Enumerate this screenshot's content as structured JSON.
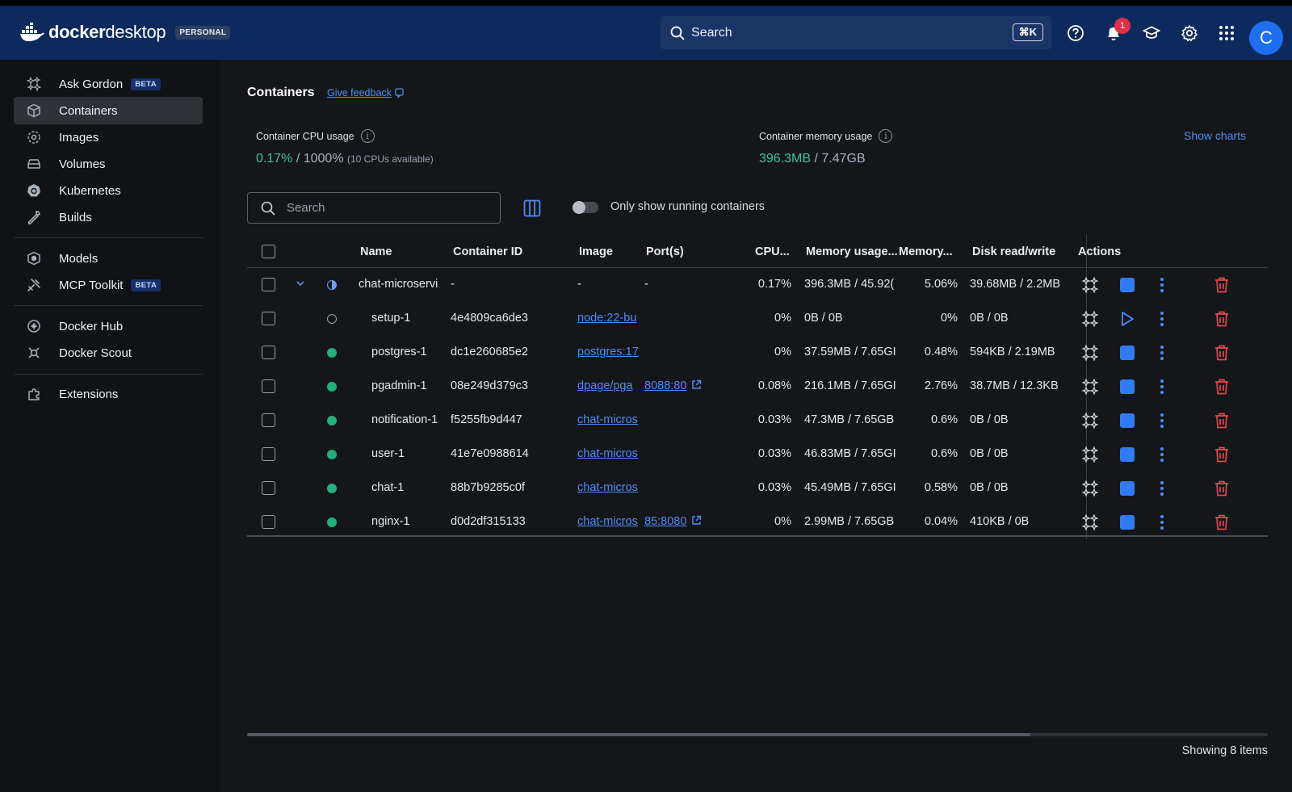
{
  "app": {
    "logo_text_bold": "docker",
    "logo_text": "desktop",
    "plan_badge": "PERSONAL"
  },
  "topbar": {
    "search_label": "Search",
    "shortcut": "⌘K",
    "notifications_count": "1",
    "avatar_letter": "C"
  },
  "sidebar": {
    "items": [
      {
        "label": "Ask Gordon",
        "badge": "BETA",
        "icon": "sparkle-icon"
      },
      {
        "label": "Containers",
        "icon": "container-icon",
        "active": true
      },
      {
        "label": "Images",
        "icon": "image-icon"
      },
      {
        "label": "Volumes",
        "icon": "volume-icon"
      },
      {
        "label": "Kubernetes",
        "icon": "kubernetes-icon"
      },
      {
        "label": "Builds",
        "icon": "wrench-icon"
      },
      {
        "label": "Models",
        "icon": "model-icon"
      },
      {
        "label": "MCP Toolkit",
        "badge": "BETA",
        "icon": "toolkit-icon"
      },
      {
        "label": "Docker Hub",
        "icon": "hub-icon"
      },
      {
        "label": "Docker Scout",
        "icon": "scout-icon"
      },
      {
        "label": "Extensions",
        "icon": "puzzle-icon"
      }
    ]
  },
  "main": {
    "title": "Containers",
    "feedback": "Give feedback",
    "cpu": {
      "label": "Container CPU usage",
      "used": "0.17%",
      "sep": " / ",
      "total": "1000%",
      "note": "(10 CPUs available)"
    },
    "memory": {
      "label": "Container memory usage",
      "used": "396.3MB",
      "sep": " / ",
      "total": "7.47GB"
    },
    "show_charts": "Show charts",
    "search_placeholder": "Search",
    "toggle_label": "Only show running containers",
    "footer": "Showing 8 items"
  },
  "table": {
    "headers": {
      "name": "Name",
      "id": "Container ID",
      "image": "Image",
      "ports": "Port(s)",
      "cpu": "CPU...",
      "mem": "Memory usage...",
      "mem_pct": "Memory...",
      "disk": "Disk read/write",
      "actions": "Actions"
    },
    "rows": [
      {
        "name": "chat-microservi",
        "id": "-",
        "image": "-",
        "ports": "-",
        "cpu": "0.17%",
        "mem": "396.3MB / 45.92(",
        "mem_pct": "5.06%",
        "disk": "39.68MB / 2.2MB",
        "status": "partial",
        "group": true
      },
      {
        "name": "setup-1",
        "id": "4e4809ca6de3",
        "image": "node:22-bu",
        "ports": "",
        "cpu": "0%",
        "mem": "0B / 0B",
        "mem_pct": "0%",
        "disk": "0B / 0B",
        "status": "stopped"
      },
      {
        "name": "postgres-1",
        "id": "dc1e260685e2",
        "image": "postgres:17",
        "ports": "",
        "cpu": "0%",
        "mem": "37.59MB / 7.65GI",
        "mem_pct": "0.48%",
        "disk": "594KB / 2.19MB",
        "status": "running"
      },
      {
        "name": "pgadmin-1",
        "id": "08e249d379c3",
        "image": "dpage/pga",
        "ports": "8088:80",
        "cpu": "0.08%",
        "mem": "216.1MB / 7.65GI",
        "mem_pct": "2.76%",
        "disk": "38.7MB / 12.3KB",
        "status": "running"
      },
      {
        "name": "notification-1",
        "id": "f5255fb9d447",
        "image": "chat-micros",
        "ports": "",
        "cpu": "0.03%",
        "mem": "47.3MB / 7.65GB",
        "mem_pct": "0.6%",
        "disk": "0B / 0B",
        "status": "running"
      },
      {
        "name": "user-1",
        "id": "41e7e0988614",
        "image": "chat-micros",
        "ports": "",
        "cpu": "0.03%",
        "mem": "46.83MB / 7.65GI",
        "mem_pct": "0.6%",
        "disk": "0B / 0B",
        "status": "running"
      },
      {
        "name": "chat-1",
        "id": "88b7b9285c0f",
        "image": "chat-micros",
        "ports": "",
        "cpu": "0.03%",
        "mem": "45.49MB / 7.65GI",
        "mem_pct": "0.58%",
        "disk": "0B / 0B",
        "status": "running"
      },
      {
        "name": "nginx-1",
        "id": "d0d2df315133",
        "image": "chat-micros",
        "ports": "85:8080",
        "cpu": "0%",
        "mem": "2.99MB / 7.65GB",
        "mem_pct": "0.04%",
        "disk": "410KB / 0B",
        "status": "running"
      }
    ]
  },
  "colors": {
    "topbar": "#0d2a5e",
    "accent": "#4d8df6",
    "running": "#22b07d",
    "delete": "#e5484d",
    "stop": "#2f7cf6"
  }
}
